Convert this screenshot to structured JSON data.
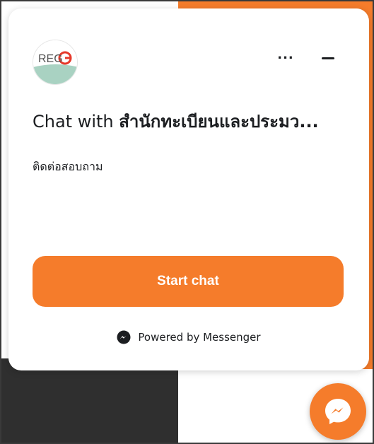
{
  "header": {
    "avatar_text": "REG",
    "more_label": "...",
    "minimize_icon": "minimize-icon"
  },
  "main": {
    "title_prefix": "Chat with ",
    "title_name": "สำนักทะเบียนและประมว...",
    "subtitle": "ติดต่อสอบถาม",
    "start_chat_label": "Start chat"
  },
  "footer": {
    "powered_by": "Powered by Messenger",
    "icon": "messenger-icon"
  },
  "colors": {
    "accent": "#f57c2b",
    "text": "#1c1e21",
    "background": "#ffffff",
    "dark_panel": "#2f2f2f"
  }
}
